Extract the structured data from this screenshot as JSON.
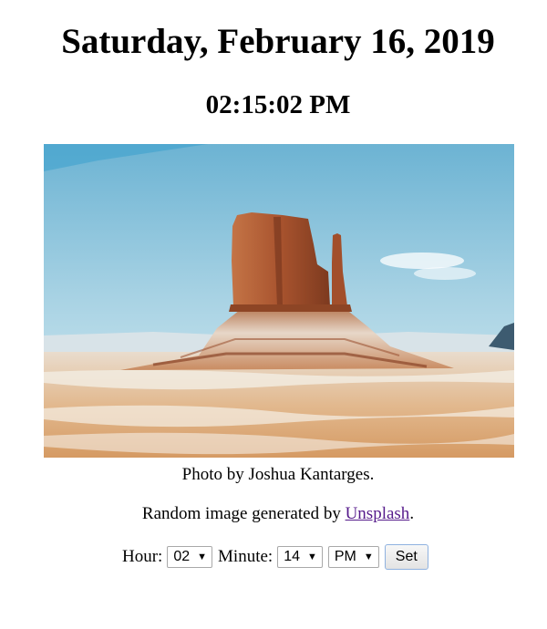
{
  "header": {
    "date": "Saturday, February 16, 2019",
    "time": "02:15:02 PM"
  },
  "photo": {
    "caption": "Photo by Joshua Kantarges."
  },
  "credit": {
    "prefix": "Random image generated by ",
    "link_label": "Unsplash",
    "suffix": "."
  },
  "controls": {
    "hour_label": "Hour:",
    "hour_value": "02",
    "minute_label": "Minute:",
    "minute_value": "14",
    "ampm_value": "PM",
    "set_label": "Set",
    "dropdown_arrow": "▼"
  },
  "colors": {
    "link": "#551a8b",
    "sky": "#9ccbe0",
    "rock": "#b3623a"
  }
}
